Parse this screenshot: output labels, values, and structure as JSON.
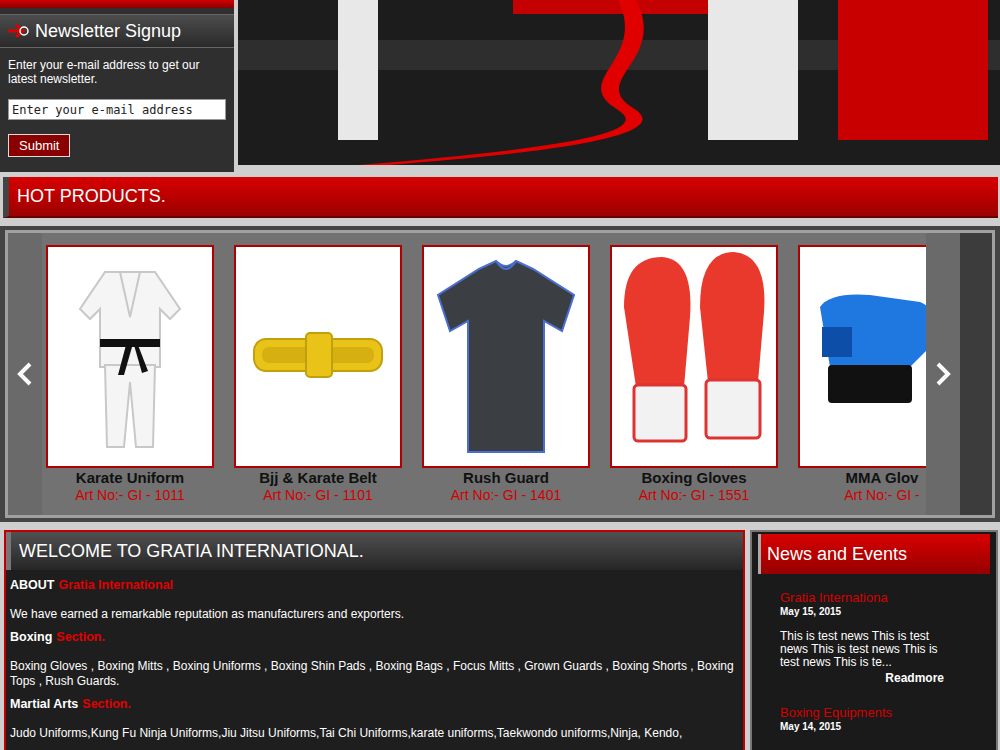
{
  "newsletter": {
    "title": "Newsletter Signup",
    "description": "Enter your e-mail address to get our latest newsletter.",
    "placeholder": "Enter your e-mail address",
    "button": "Submit"
  },
  "hot_products": {
    "title": "HOT PRODUCTS.",
    "items": [
      {
        "name": "Karate Uniform",
        "art": "Art No:- GI - 1011",
        "kind": "uniform"
      },
      {
        "name": "Bjj & Karate Belt",
        "art": "Art No:- GI - 1101",
        "kind": "belt"
      },
      {
        "name": "Rush Guard",
        "art": "Art No:- GI - 1401",
        "kind": "shirt"
      },
      {
        "name": "Boxing Gloves",
        "art": "Art No:- GI - 1551",
        "kind": "gloves"
      },
      {
        "name": "MMA Glov",
        "art": "Art No:- GI -",
        "kind": "mma"
      }
    ]
  },
  "welcome": {
    "title": "WELCOME TO GRATIA INTERNATIONAL.",
    "sections": [
      {
        "heading": "ABOUT",
        "accent": "Gratia International",
        "text": "We have earned a remarkable reputation as manufacturers and exporters."
      },
      {
        "heading": "Boxing",
        "accent": "Section.",
        "text": "Boxing Gloves , Boxing Mitts , Boxing Uniforms , Boxing Shin Pads , Boxing Bags , Focus Mitts , Grown Guards , Boxing Shorts , Boxing Tops , Rush Guards."
      },
      {
        "heading": "Martial Arts",
        "accent": "Section.",
        "text": "Judo Uniforms,Kung Fu Ninja Uniforms,Jiu Jitsu Uniforms,Tai Chi Uniforms,karate uniforms,Taekwondo uniforms,Ninja, Kendo,"
      }
    ]
  },
  "news": {
    "title": "News and Events",
    "items": [
      {
        "title": "Gratia Internationa",
        "date": "May 15, 2015",
        "body": "This is test news This is test news This is test news This is test news This is te...",
        "more": "Readmore"
      },
      {
        "title": "Boxing Equipments",
        "date": "May 14, 2015"
      }
    ]
  }
}
